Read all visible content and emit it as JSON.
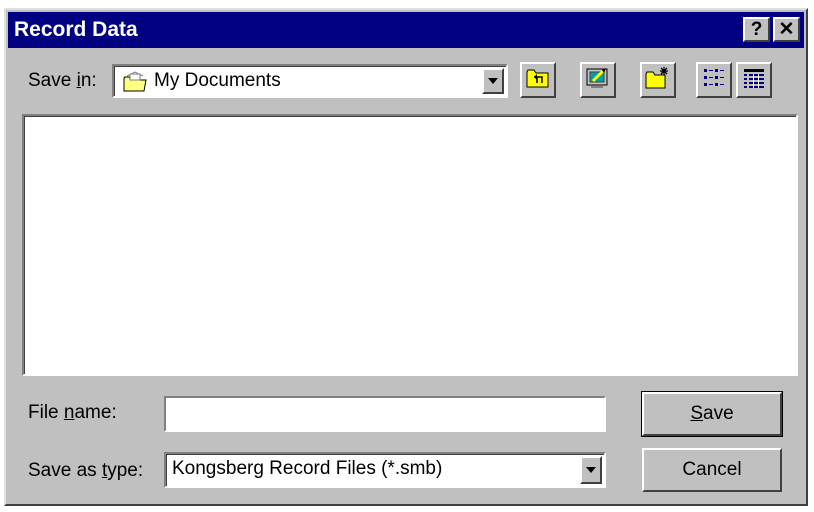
{
  "window": {
    "title": "Record Data",
    "help_glyph": "?",
    "close_glyph": "✕"
  },
  "save_in": {
    "label_pre": "Save ",
    "label_accel": "i",
    "label_post": "n:",
    "value": "My Documents",
    "value_icon": "folder-icon"
  },
  "toolbar": {
    "icons": [
      "up-one-level-icon",
      "desktop-icon",
      "new-folder-icon",
      "list-view-icon",
      "details-view-icon"
    ]
  },
  "file_name": {
    "label_pre": "File ",
    "label_accel": "n",
    "label_post": "ame:",
    "value": ""
  },
  "save_as_type": {
    "label_pre": "Save as ",
    "label_accel": "t",
    "label_post": "ype:",
    "value": "Kongsberg Record Files (*.smb)"
  },
  "buttons": {
    "save_accel": "S",
    "save_rest": "ave",
    "cancel": "Cancel"
  },
  "colors": {
    "titlebar": "#000080",
    "face": "#c0c0c0"
  }
}
